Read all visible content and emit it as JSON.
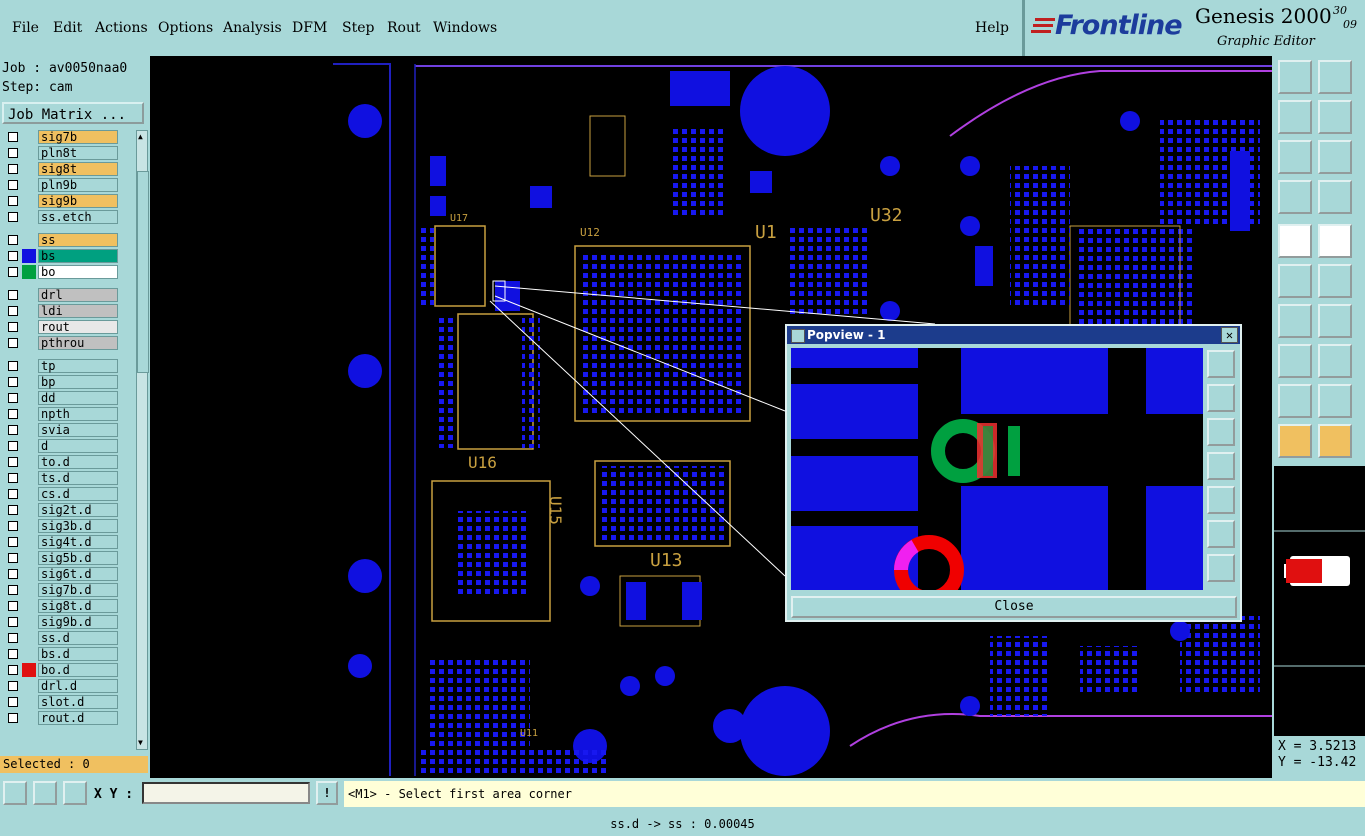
{
  "menu": {
    "file": "File",
    "edit": "Edit",
    "actions": "Actions",
    "options": "Options",
    "analysis": "Analysis",
    "dfm": "DFM",
    "step": "Step",
    "rout": "Rout",
    "windows": "Windows",
    "help": "Help"
  },
  "brand": {
    "logo": "Frontline",
    "product": "Genesis 2000",
    "subtitle": "Graphic Editor",
    "ver1": "30",
    "ver2": "09"
  },
  "job": {
    "job_line": "Job : av0050naa0",
    "step_line": "Step: cam",
    "matrix_label": "Job Matrix ..."
  },
  "layers": [
    {
      "name": "sig7b",
      "color": "#f0c060"
    },
    {
      "name": "pln8t",
      "color": "#a8d8d8"
    },
    {
      "name": "sig8t",
      "color": "#f0c060"
    },
    {
      "name": "pln9b",
      "color": "#a8d8d8"
    },
    {
      "name": "sig9b",
      "color": "#f0c060"
    },
    {
      "name": "ss.etch",
      "color": "#a8d8d8"
    },
    {
      "name": "ss",
      "color": "#f0c060"
    },
    {
      "name": "bs",
      "color": "#00a080"
    },
    {
      "name": "bo",
      "color": "#ffffff"
    },
    {
      "name": "drl",
      "color": "#c0c0c0"
    },
    {
      "name": "ldi",
      "color": "#c0c0c0"
    },
    {
      "name": "rout",
      "color": "#e8e8e8"
    },
    {
      "name": "pthrou",
      "color": "#c0c0c0"
    },
    {
      "name": "tp",
      "color": "#a8d8d8"
    },
    {
      "name": "bp",
      "color": "#a8d8d8"
    },
    {
      "name": "dd",
      "color": "#a8d8d8"
    },
    {
      "name": "npth",
      "color": "#a8d8d8"
    },
    {
      "name": "svia",
      "color": "#a8d8d8"
    },
    {
      "name": "d",
      "color": "#a8d8d8"
    },
    {
      "name": "to.d",
      "color": "#a8d8d8"
    },
    {
      "name": "ts.d",
      "color": "#a8d8d8"
    },
    {
      "name": "cs.d",
      "color": "#a8d8d8"
    },
    {
      "name": "sig2t.d",
      "color": "#a8d8d8"
    },
    {
      "name": "sig3b.d",
      "color": "#a8d8d8"
    },
    {
      "name": "sig4t.d",
      "color": "#a8d8d8"
    },
    {
      "name": "sig5b.d",
      "color": "#a8d8d8"
    },
    {
      "name": "sig6t.d",
      "color": "#a8d8d8"
    },
    {
      "name": "sig7b.d",
      "color": "#a8d8d8"
    },
    {
      "name": "sig8t.d",
      "color": "#a8d8d8"
    },
    {
      "name": "sig9b.d",
      "color": "#a8d8d8"
    },
    {
      "name": "ss.d",
      "color": "#a8d8d8"
    },
    {
      "name": "bs.d",
      "color": "#a8d8d8"
    },
    {
      "name": "bo.d",
      "color": "#a8d8d8"
    },
    {
      "name": "drl.d",
      "color": "#a8d8d8"
    },
    {
      "name": "slot.d",
      "color": "#a8d8d8"
    },
    {
      "name": "rout.d",
      "color": "#a8d8d8"
    }
  ],
  "selected": "Selected : 0",
  "popview": {
    "title": "Popview - 1",
    "close": "Close"
  },
  "coords": {
    "x": "X = 3.5213",
    "y": "Y = -13.42"
  },
  "bottom": {
    "xy_label": "X Y :",
    "xy_value": "",
    "prompt": "<M1> - Select first area corner",
    "info": "!"
  },
  "status": "ss.d -> ss : 0.00045",
  "canvas_labels": [
    "U1",
    "U32",
    "U16",
    "U13",
    "U15",
    "U17",
    "U12",
    "U11"
  ]
}
